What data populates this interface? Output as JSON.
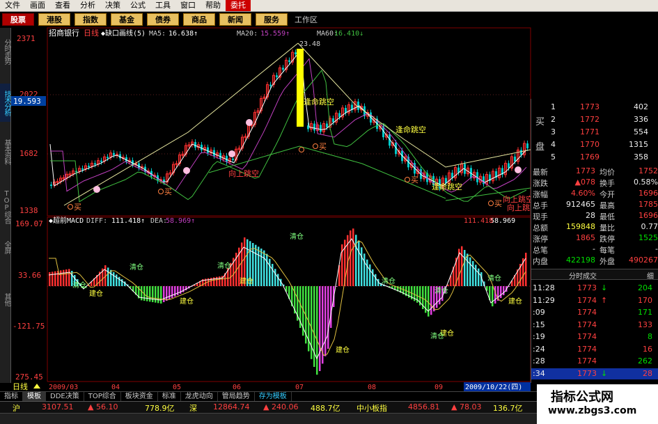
{
  "menu": [
    {
      "label": "文件",
      "active": false
    },
    {
      "label": "画面",
      "active": false
    },
    {
      "label": "查看",
      "active": false
    },
    {
      "label": "分析",
      "active": false
    },
    {
      "label": "决策",
      "active": false
    },
    {
      "label": "公式",
      "active": false
    },
    {
      "label": "工具",
      "active": false
    },
    {
      "label": "窗口",
      "active": false
    },
    {
      "label": "帮助",
      "active": false
    },
    {
      "label": "委托",
      "active": true
    }
  ],
  "toolbar": {
    "stock": "股票",
    "buttons": [
      "港股",
      "指数",
      "基金",
      "债券",
      "商品",
      "新闻",
      "服务"
    ],
    "area": "工作区"
  },
  "lefttabs": [
    {
      "label": "分时走势",
      "active": false
    },
    {
      "label": "技术分析",
      "active": true
    },
    {
      "label": "基本资料",
      "active": false
    },
    {
      "label": "TOP综合",
      "active": false
    },
    {
      "label": "全屏",
      "active": false
    },
    {
      "label": "其他",
      "active": false
    }
  ],
  "main": {
    "title": "招商银行",
    "period": "日线",
    "indicator": "◆缺口画线(5)",
    "ma5_label": "MA5:",
    "ma5_value": "16.638↑",
    "ma20_label": "MA20:",
    "ma20_value": "15.559↑",
    "ma60_label": "MA60:",
    "ma60_value": "16.410↓",
    "price_axis": [
      "2371",
      "2022",
      "1682",
      "1338"
    ],
    "price_box": "19.593",
    "peak": "23.48",
    "annotations": {
      "ding_kong": "逢命跳空",
      "up_jump": "向上跳空",
      "buy": "买"
    }
  },
  "macd": {
    "title": "◆超前MACD",
    "diff_label": "DIFF:",
    "diff_value": "111.418↑",
    "dea_label": "DEA:",
    "dea_value": "58.969↑",
    "right_value": "58.969",
    "right_diff": "111.418",
    "axis": [
      "169.07",
      "33.66",
      "-121.75",
      "275.45"
    ],
    "jiancang": "建仓",
    "qingcang": "清仓"
  },
  "dates": {
    "period_label": "日线",
    "ticks": [
      "2009/03",
      "04",
      "05",
      "06",
      "07",
      "08",
      "09"
    ],
    "current": "2009/10/22(四)"
  },
  "orderbook": {
    "buy_label": [
      "买",
      "盘"
    ],
    "rows": [
      {
        "n": "1",
        "price": "1773",
        "vol": "402"
      },
      {
        "n": "2",
        "price": "1772",
        "vol": "336"
      },
      {
        "n": "3",
        "price": "1771",
        "vol": "554"
      },
      {
        "n": "4",
        "price": "1770",
        "vol": "1315"
      },
      {
        "n": "5",
        "price": "1769",
        "vol": "358"
      }
    ]
  },
  "quote": [
    {
      "l1": "最新",
      "v1": "1773",
      "l2": "均价",
      "v2": "1752"
    },
    {
      "l1": "涨跌",
      "v1": "▲078",
      "l2": "换手",
      "v2": "0.58%"
    },
    {
      "l1": "涨幅",
      "v1": "4.60%",
      "l2": "今开",
      "v2": "1696"
    },
    {
      "l1": "总手",
      "v1": "912465",
      "l2": "最高",
      "v2": "1785"
    },
    {
      "l1": "现手",
      "v1": "28",
      "l2": "最低",
      "v2": "1696"
    },
    {
      "l1": "总额",
      "v1": "159848",
      "l2": "量比",
      "v2": "0.77"
    },
    {
      "l1": "涨停",
      "v1": "1865",
      "l2": "跌停",
      "v2": "1525"
    },
    {
      "l1": "总笔",
      "v1": "-",
      "l2": "每笔",
      "v2": "-"
    },
    {
      "l1": "内盘",
      "v1": "422198",
      "l2": "外盘",
      "v2": "490267"
    }
  ],
  "ticks_panel": {
    "title": "分时成交",
    "detail": "细",
    "rows": [
      {
        "time": "11:28",
        "price": "1773",
        "arrow": "↓",
        "vol": "204"
      },
      {
        "time": "11:29",
        "price": "1774",
        "arrow": "↑",
        "vol": "170"
      },
      {
        "time": ":09",
        "price": "1774",
        "arrow": "",
        "vol": "171"
      },
      {
        "time": ":15",
        "price": "1774",
        "arrow": "",
        "vol": "133"
      },
      {
        "time": ":19",
        "price": "1774",
        "arrow": "",
        "vol": "8"
      },
      {
        "time": ":24",
        "price": "1774",
        "arrow": "",
        "vol": "16"
      },
      {
        "time": ":28",
        "price": "1774",
        "arrow": "",
        "vol": "262"
      },
      {
        "time": ":34",
        "price": "1773",
        "arrow": "↓",
        "vol": "28"
      }
    ]
  },
  "bottom_tabs": [
    "指标",
    "模板",
    "DDE决策",
    "TOP综合",
    "板块资金",
    "标准",
    "龙虎动向",
    "管局趋势",
    "存为模板"
  ],
  "status": {
    "sh_label": "沪",
    "sh_index": "3107.51",
    "sh_change": "56.10",
    "sh_amount": "778.9亿",
    "sz_label": "深",
    "sz_index": "12864.74",
    "sz_change": "240.06",
    "sz_amount": "488.7亿",
    "zx_label": "中小板指",
    "zx_index": "4856.81",
    "zx_change": "78.03",
    "zx_amount": "136.7亿"
  },
  "watermark": {
    "title": "指标公式网",
    "url": "www.zbgs3.com"
  },
  "colors": {
    "up": "#ff3030",
    "down": "#00c8c8",
    "ma5": "#ffffff",
    "ma20": "#c040c0",
    "ma60": "#40c040"
  }
}
